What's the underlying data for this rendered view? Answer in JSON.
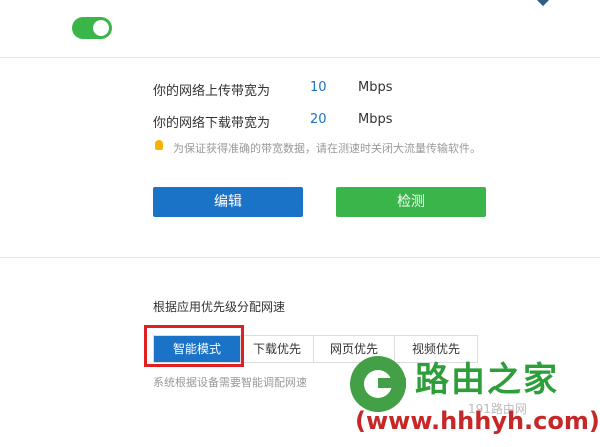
{
  "bandwidth": {
    "upload_label": "你的网络上传带宽为",
    "upload_value": "10",
    "upload_unit": "Mbps",
    "download_label": "你的网络下载带宽为",
    "download_value": "20",
    "download_unit": "Mbps",
    "tip": "为保证获得准确的带宽数据，请在测速时关闭大流量传输软件。",
    "edit_label": "编辑",
    "detect_label": "检测"
  },
  "priority": {
    "title": "根据应用优先级分配网速",
    "modes": [
      {
        "label": "智能模式",
        "active": true
      },
      {
        "label": "下载优先",
        "active": false
      },
      {
        "label": "网页优先",
        "active": false
      },
      {
        "label": "视频优先",
        "active": false
      }
    ],
    "description": "系统根据设备需要智能调配网速"
  },
  "watermark": {
    "title": "路由之家",
    "sub": "191路由网",
    "url": "(www.hhhyh.com)"
  },
  "colors": {
    "primary_blue": "#1b73c8",
    "success_green": "#3ab54a",
    "highlight_red": "#e02020"
  }
}
